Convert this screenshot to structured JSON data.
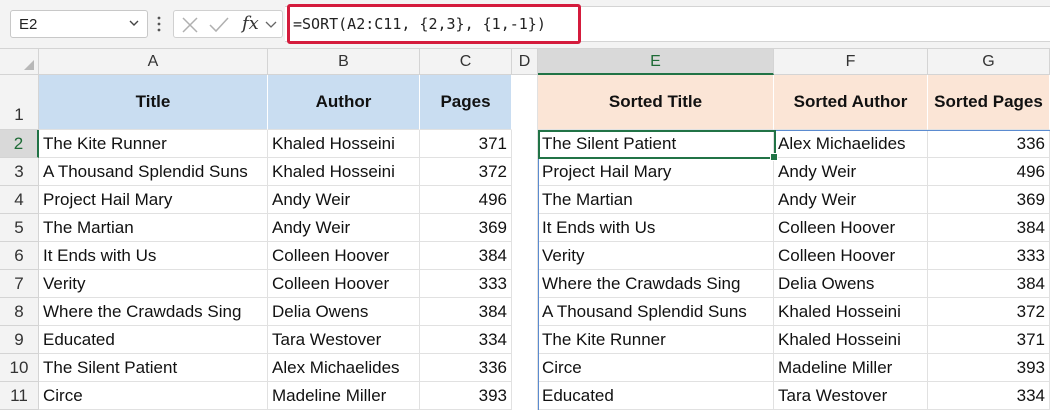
{
  "name_box": {
    "value": "E2"
  },
  "formula_bar": {
    "formula": "=SORT(A2:C11, {2,3}, {1,-1})",
    "fx_label": "fx"
  },
  "columns": [
    "A",
    "B",
    "C",
    "D",
    "E",
    "F",
    "G"
  ],
  "rows": [
    "1",
    "2",
    "3",
    "4",
    "5",
    "6",
    "7",
    "8",
    "9",
    "10",
    "11"
  ],
  "left_table": {
    "headers": [
      "Title",
      "Author",
      "Pages"
    ],
    "rows": [
      [
        "The Kite Runner",
        "Khaled Hosseini",
        "371"
      ],
      [
        "A Thousand Splendid Suns",
        "Khaled Hosseini",
        "372"
      ],
      [
        "Project Hail Mary",
        "Andy Weir",
        "496"
      ],
      [
        "The Martian",
        "Andy Weir",
        "369"
      ],
      [
        "It Ends with Us",
        "Colleen Hoover",
        "384"
      ],
      [
        "Verity",
        "Colleen Hoover",
        "333"
      ],
      [
        "Where the Crawdads Sing",
        "Delia Owens",
        "384"
      ],
      [
        "Educated",
        "Tara Westover",
        "334"
      ],
      [
        "The Silent Patient",
        "Alex Michaelides",
        "336"
      ],
      [
        "Circe",
        "Madeline Miller",
        "393"
      ]
    ]
  },
  "right_table": {
    "headers": [
      "Sorted Title",
      "Sorted Author",
      "Sorted Pages"
    ],
    "rows": [
      [
        "The Silent Patient",
        "Alex Michaelides",
        "336"
      ],
      [
        "Project Hail Mary",
        "Andy Weir",
        "496"
      ],
      [
        "The Martian",
        "Andy Weir",
        "369"
      ],
      [
        "It Ends with Us",
        "Colleen Hoover",
        "384"
      ],
      [
        "Verity",
        "Colleen Hoover",
        "333"
      ],
      [
        "Where the Crawdads Sing",
        "Delia Owens",
        "384"
      ],
      [
        "A Thousand Splendid Suns",
        "Khaled Hosseini",
        "372"
      ],
      [
        "The Kite Runner",
        "Khaled Hosseini",
        "371"
      ],
      [
        "Circe",
        "Madeline Miller",
        "393"
      ],
      [
        "Educated",
        "Tara Westover",
        "334"
      ]
    ]
  },
  "colors": {
    "left_header_fill": "#c9ddf1",
    "right_header_fill": "#fbe5d6",
    "selection": "#217346",
    "formula_highlight": "#d41b3c"
  },
  "icons": [
    "chevron-down-icon",
    "more-options-icon",
    "cancel-icon",
    "enter-icon",
    "fx-icon",
    "select-all-icon"
  ]
}
